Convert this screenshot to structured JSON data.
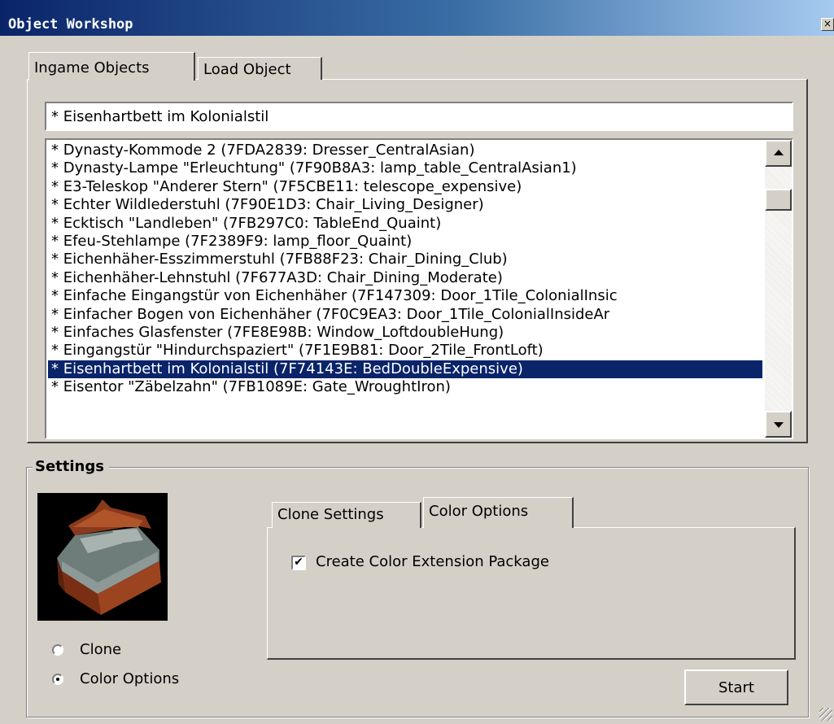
{
  "window": {
    "title": "Object Workshop",
    "close_icon": "×"
  },
  "tabs": [
    {
      "label": "Ingame Objects",
      "active": true
    },
    {
      "label": "Load Object",
      "active": false
    }
  ],
  "search": {
    "value": "* Eisenhartbett im Kolonialstil"
  },
  "object_list": {
    "items": [
      "* Dynasty-Kommode 2 (7FDA2839: Dresser_CentralAsian)",
      "* Dynasty-Lampe \"Erleuchtung\" (7F90B8A3: lamp_table_CentralAsian1)",
      "* E3-Teleskop \"Anderer Stern\" (7F5CBE11: telescope_expensive)",
      "* Echter Wildlederstuhl (7F90E1D3: Chair_Living_Designer)",
      "* Ecktisch \"Landleben\" (7FB297C0: TableEnd_Quaint)",
      "* Efeu-Stehlampe (7F2389F9: lamp_floor_Quaint)",
      "* Eichenhäher-Esszimmerstuhl (7FB88F23: Chair_Dining_Club)",
      "* Eichenhäher-Lehnstuhl (7F677A3D: Chair_Dining_Moderate)",
      "* Einfache Eingangstür von Eichenhäher (7F147309: Door_1Tile_ColonialInsic",
      "* Einfacher Bogen von Eichenhäher (7F0C9EA3: Door_1Tile_ColonialInsideAr",
      "* Einfaches Glasfenster (7FE8E98B: Window_LoftdoubleHung)",
      "* Eingangstür \"Hindurchspaziert\" (7F1E9B81: Door_2Tile_FrontLoft)",
      "* Eisenhartbett im Kolonialstil (7F74143E: BedDoubleExpensive)",
      "* Eisentor \"Zäbelzahn\" (7FB1089E: Gate_WroughtIron)"
    ],
    "selected_index": 12
  },
  "settings": {
    "label": "Settings",
    "radios": [
      {
        "label": "Clone",
        "checked": false
      },
      {
        "label": "Color Options",
        "checked": true
      }
    ],
    "inner_tabs": [
      {
        "label": "Clone Settings",
        "active": false
      },
      {
        "label": "Color Options",
        "active": true
      }
    ],
    "checkbox": {
      "label": "Create Color Extension Package",
      "checked": true,
      "mark": "✔"
    },
    "start_label": "Start"
  },
  "colors": {
    "selection": "#0a246a",
    "face": "#d4d0c8"
  }
}
